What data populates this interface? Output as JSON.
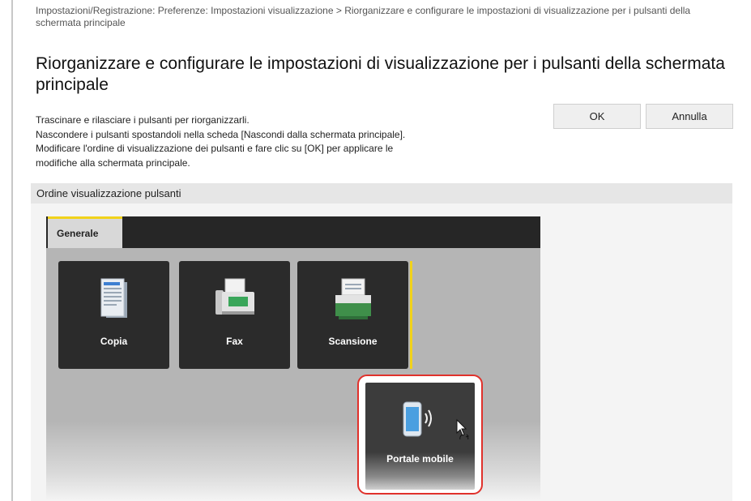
{
  "breadcrumb": "Impostazioni/Registrazione: Preferenze: Impostazioni visualizzazione > Riorganizzare e configurare le impostazioni di visualizzazione per i pulsanti della schermata principale",
  "title": "Riorganizzare e configurare le impostazioni di visualizzazione per i pulsanti della schermata principale",
  "instructions": [
    "Trascinare e rilasciare i pulsanti per riorganizzarli.",
    "Nascondere i pulsanti spostandoli nella scheda [Nascondi dalla schermata principale].",
    "Modificare l'ordine di visualizzazione dei pulsanti e fare clic su [OK] per applicare le",
    "modifiche alla schermata principale."
  ],
  "buttons": {
    "ok": "OK",
    "cancel": "Annulla"
  },
  "section": {
    "title": "Ordine visualizzazione pulsanti"
  },
  "device": {
    "active_tab": "Generale",
    "tiles": [
      {
        "label": "Copia",
        "icon": "copy-icon"
      },
      {
        "label": "Fax",
        "icon": "fax-icon"
      },
      {
        "label": "Scansione",
        "icon": "scan-icon"
      }
    ],
    "dragged_tile": {
      "label": "Portale mobile",
      "icon": "mobile-portal-icon"
    }
  },
  "colors": {
    "tab_accent": "#f1d21b",
    "tile_background": "#2b2b2b",
    "highlight_border": "#e0312b",
    "fax_green": "#3aa65a",
    "scan_green": "#3f8f4a",
    "phone_blue": "#4a9fe0"
  }
}
